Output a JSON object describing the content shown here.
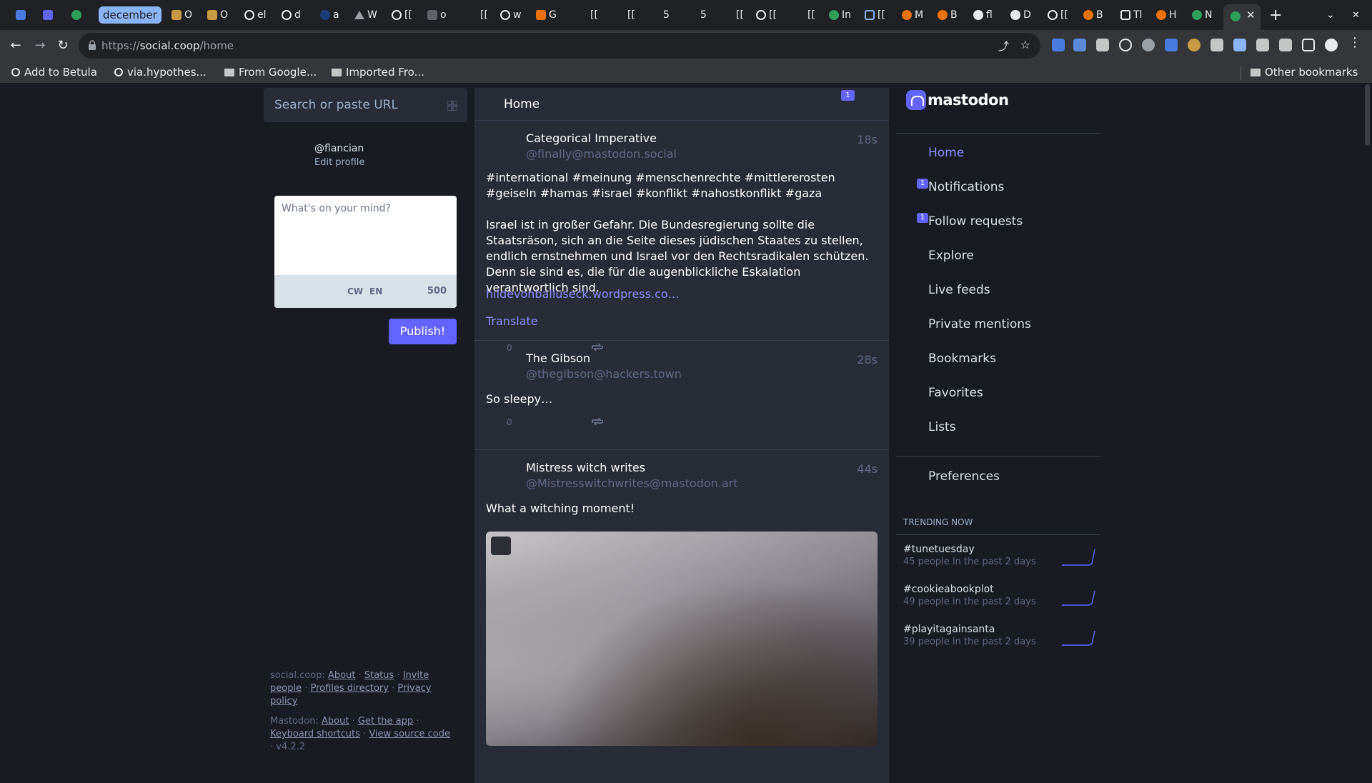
{
  "browser": {
    "active_tab_label": "december",
    "tabs": [
      "O",
      "O",
      "el",
      "d",
      "a",
      "W",
      "[[",
      "o",
      "[[",
      "w",
      "G",
      "[[",
      "[[",
      "5",
      "5",
      "[[",
      "[[",
      "[[",
      "In",
      "[[",
      "M",
      "B",
      "fl",
      "D",
      "[[",
      "B",
      "Tl",
      "H",
      "N"
    ],
    "url_prefix": "https://",
    "url_host": "social.coop",
    "url_path": "/home",
    "bookmarks": [
      "Add to Betula",
      "via.hypothes...",
      "From Google...",
      "Imported Fro..."
    ],
    "other_bookmarks": "Other bookmarks"
  },
  "search": {
    "placeholder": "Search or paste URL"
  },
  "profile": {
    "acct": "@flancian",
    "edit": "Edit profile"
  },
  "compose": {
    "placeholder": "What's on your mind?",
    "cw": "CW",
    "lang": "EN",
    "counter": "500",
    "publish": "Publish!"
  },
  "timeline": {
    "title": "Home",
    "badge": "1",
    "statuses": [
      {
        "name": "Categorical Imperative",
        "acct": "@finally@mastodon.social",
        "time": "18s",
        "tags": "#international #meinung #menschenrechte #mittlererosten #geiseln #hamas #israel #konflikt #nahostkonflikt #gaza",
        "body": "Israel ist in großer Gefahr. Die Bundesregierung sollte die Staatsräson, sich an die Seite dieses jüdischen Staates zu stellen, endlich ernstnehmen und Israel vor den Rechtsradikalen schützen. Denn sie sind es, die für die augenblickliche Eskalation verantwortlich sind.",
        "link": "hildevonballuseck.wordpress.co…",
        "translate": "Translate",
        "replies": "0"
      },
      {
        "name": "The Gibson",
        "acct": "@thegibson@hackers.town",
        "time": "28s",
        "body": "So sleepy…",
        "replies": "0"
      },
      {
        "name": "Mistress witch writes",
        "acct": "@Mistresswitchwrites@mastodon.art",
        "time": "44s",
        "body": "What a witching moment!"
      }
    ]
  },
  "nav": {
    "logo": "mastodon",
    "items": [
      {
        "label": "Home",
        "active": true
      },
      {
        "label": "Notifications",
        "badge": "1"
      },
      {
        "label": "Follow requests",
        "badge": "1"
      },
      {
        "label": "Explore"
      },
      {
        "label": "Live feeds"
      },
      {
        "label": "Private mentions"
      },
      {
        "label": "Bookmarks"
      },
      {
        "label": "Favorites"
      },
      {
        "label": "Lists"
      }
    ],
    "preferences": "Preferences"
  },
  "trending": {
    "heading": "TRENDING NOW",
    "items": [
      {
        "tag": "#tunetuesday",
        "sub": "45 people in the past 2 days"
      },
      {
        "tag": "#cookieabookplot",
        "sub": "49 people in the past 2 days"
      },
      {
        "tag": "#playitagainsanta",
        "sub": "39 people in the past 2 days"
      }
    ]
  },
  "footer": {
    "server": "social.coop:",
    "server_links": [
      "About",
      "Status",
      "Invite people",
      "Profiles directory",
      "Privacy policy"
    ],
    "mastodon": "Mastodon:",
    "mastodon_links": [
      "About",
      "Get the app",
      "Keyboard shortcuts",
      "View source code"
    ],
    "version": "v4.2.2"
  },
  "colors": {
    "accent": "#6364ff",
    "link": "#8c8dff",
    "bg": "#191b22",
    "panel": "#282c37"
  }
}
